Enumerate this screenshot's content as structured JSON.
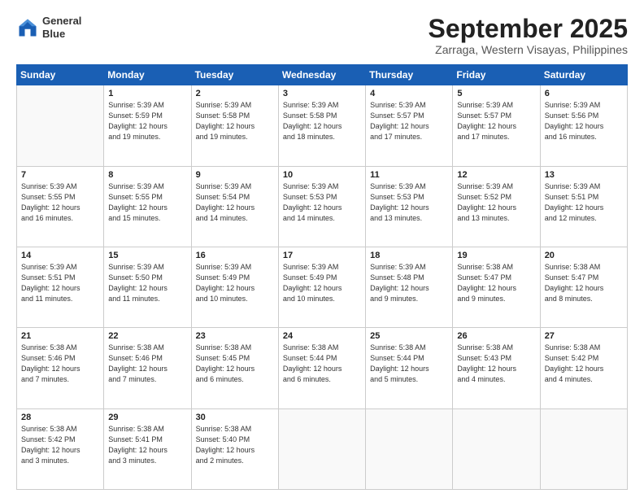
{
  "logo": {
    "line1": "General",
    "line2": "Blue"
  },
  "header": {
    "month": "September 2025",
    "location": "Zarraga, Western Visayas, Philippines"
  },
  "days": [
    "Sunday",
    "Monday",
    "Tuesday",
    "Wednesday",
    "Thursday",
    "Friday",
    "Saturday"
  ],
  "weeks": [
    [
      {
        "num": "",
        "info": ""
      },
      {
        "num": "1",
        "info": "Sunrise: 5:39 AM\nSunset: 5:59 PM\nDaylight: 12 hours\nand 19 minutes."
      },
      {
        "num": "2",
        "info": "Sunrise: 5:39 AM\nSunset: 5:58 PM\nDaylight: 12 hours\nand 19 minutes."
      },
      {
        "num": "3",
        "info": "Sunrise: 5:39 AM\nSunset: 5:58 PM\nDaylight: 12 hours\nand 18 minutes."
      },
      {
        "num": "4",
        "info": "Sunrise: 5:39 AM\nSunset: 5:57 PM\nDaylight: 12 hours\nand 17 minutes."
      },
      {
        "num": "5",
        "info": "Sunrise: 5:39 AM\nSunset: 5:57 PM\nDaylight: 12 hours\nand 17 minutes."
      },
      {
        "num": "6",
        "info": "Sunrise: 5:39 AM\nSunset: 5:56 PM\nDaylight: 12 hours\nand 16 minutes."
      }
    ],
    [
      {
        "num": "7",
        "info": "Sunrise: 5:39 AM\nSunset: 5:55 PM\nDaylight: 12 hours\nand 16 minutes."
      },
      {
        "num": "8",
        "info": "Sunrise: 5:39 AM\nSunset: 5:55 PM\nDaylight: 12 hours\nand 15 minutes."
      },
      {
        "num": "9",
        "info": "Sunrise: 5:39 AM\nSunset: 5:54 PM\nDaylight: 12 hours\nand 14 minutes."
      },
      {
        "num": "10",
        "info": "Sunrise: 5:39 AM\nSunset: 5:53 PM\nDaylight: 12 hours\nand 14 minutes."
      },
      {
        "num": "11",
        "info": "Sunrise: 5:39 AM\nSunset: 5:53 PM\nDaylight: 12 hours\nand 13 minutes."
      },
      {
        "num": "12",
        "info": "Sunrise: 5:39 AM\nSunset: 5:52 PM\nDaylight: 12 hours\nand 13 minutes."
      },
      {
        "num": "13",
        "info": "Sunrise: 5:39 AM\nSunset: 5:51 PM\nDaylight: 12 hours\nand 12 minutes."
      }
    ],
    [
      {
        "num": "14",
        "info": "Sunrise: 5:39 AM\nSunset: 5:51 PM\nDaylight: 12 hours\nand 11 minutes."
      },
      {
        "num": "15",
        "info": "Sunrise: 5:39 AM\nSunset: 5:50 PM\nDaylight: 12 hours\nand 11 minutes."
      },
      {
        "num": "16",
        "info": "Sunrise: 5:39 AM\nSunset: 5:49 PM\nDaylight: 12 hours\nand 10 minutes."
      },
      {
        "num": "17",
        "info": "Sunrise: 5:39 AM\nSunset: 5:49 PM\nDaylight: 12 hours\nand 10 minutes."
      },
      {
        "num": "18",
        "info": "Sunrise: 5:39 AM\nSunset: 5:48 PM\nDaylight: 12 hours\nand 9 minutes."
      },
      {
        "num": "19",
        "info": "Sunrise: 5:38 AM\nSunset: 5:47 PM\nDaylight: 12 hours\nand 9 minutes."
      },
      {
        "num": "20",
        "info": "Sunrise: 5:38 AM\nSunset: 5:47 PM\nDaylight: 12 hours\nand 8 minutes."
      }
    ],
    [
      {
        "num": "21",
        "info": "Sunrise: 5:38 AM\nSunset: 5:46 PM\nDaylight: 12 hours\nand 7 minutes."
      },
      {
        "num": "22",
        "info": "Sunrise: 5:38 AM\nSunset: 5:46 PM\nDaylight: 12 hours\nand 7 minutes."
      },
      {
        "num": "23",
        "info": "Sunrise: 5:38 AM\nSunset: 5:45 PM\nDaylight: 12 hours\nand 6 minutes."
      },
      {
        "num": "24",
        "info": "Sunrise: 5:38 AM\nSunset: 5:44 PM\nDaylight: 12 hours\nand 6 minutes."
      },
      {
        "num": "25",
        "info": "Sunrise: 5:38 AM\nSunset: 5:44 PM\nDaylight: 12 hours\nand 5 minutes."
      },
      {
        "num": "26",
        "info": "Sunrise: 5:38 AM\nSunset: 5:43 PM\nDaylight: 12 hours\nand 4 minutes."
      },
      {
        "num": "27",
        "info": "Sunrise: 5:38 AM\nSunset: 5:42 PM\nDaylight: 12 hours\nand 4 minutes."
      }
    ],
    [
      {
        "num": "28",
        "info": "Sunrise: 5:38 AM\nSunset: 5:42 PM\nDaylight: 12 hours\nand 3 minutes."
      },
      {
        "num": "29",
        "info": "Sunrise: 5:38 AM\nSunset: 5:41 PM\nDaylight: 12 hours\nand 3 minutes."
      },
      {
        "num": "30",
        "info": "Sunrise: 5:38 AM\nSunset: 5:40 PM\nDaylight: 12 hours\nand 2 minutes."
      },
      {
        "num": "",
        "info": ""
      },
      {
        "num": "",
        "info": ""
      },
      {
        "num": "",
        "info": ""
      },
      {
        "num": "",
        "info": ""
      }
    ]
  ]
}
